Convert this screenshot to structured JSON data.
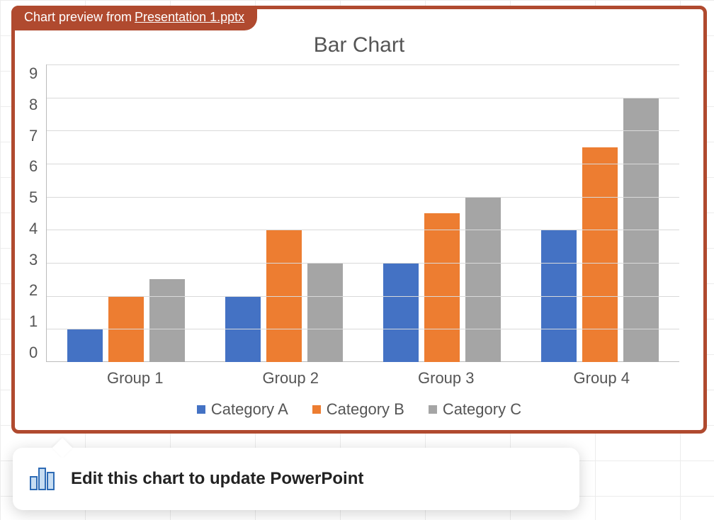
{
  "preview_tab": {
    "prefix": "Chart preview from ",
    "filename": "Presentation 1.pptx"
  },
  "chart_data": {
    "type": "bar",
    "title": "Bar Chart",
    "categories": [
      "Group 1",
      "Group 2",
      "Group 3",
      "Group 4"
    ],
    "series": [
      {
        "name": "Category A",
        "values": [
          1,
          2,
          3,
          4
        ],
        "color": "#4472c4"
      },
      {
        "name": "Category B",
        "values": [
          2,
          4,
          4.5,
          6.5
        ],
        "color": "#ed7d31"
      },
      {
        "name": "Category C",
        "values": [
          2.5,
          3,
          5,
          8
        ],
        "color": "#a5a5a5"
      }
    ],
    "ylim": [
      0,
      9
    ],
    "yticks": [
      0,
      1,
      2,
      3,
      4,
      5,
      6,
      7,
      8,
      9
    ],
    "xlabel": "",
    "ylabel": ""
  },
  "callout": {
    "text": "Edit this chart to update PowerPoint"
  }
}
